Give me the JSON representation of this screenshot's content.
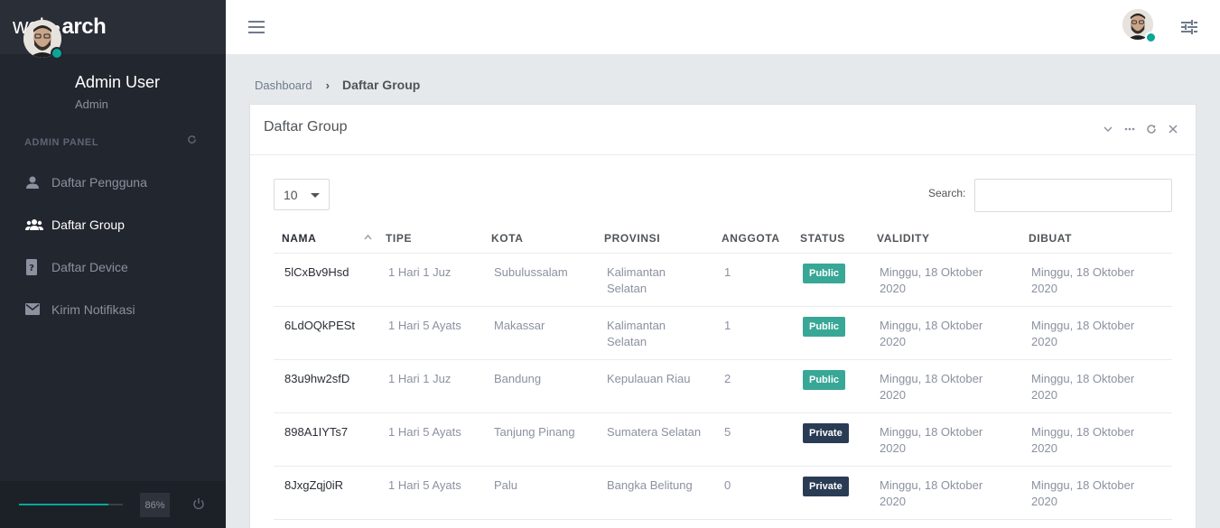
{
  "brand": {
    "part1": "web",
    "part2": "arch"
  },
  "colors": {
    "accent": "#0aa699",
    "sidebar_bg": "#22262e",
    "public_badge": "#38a796",
    "private_badge": "#2a3b54"
  },
  "user": {
    "name": "Admin User",
    "role": "Admin",
    "avatar": "avatar-photo"
  },
  "sidebar": {
    "panel_title": "ADMIN PANEL",
    "items": [
      {
        "label": "Daftar Pengguna",
        "icon": "user-icon",
        "active": false
      },
      {
        "label": "Daftar Group",
        "icon": "users-icon",
        "active": true
      },
      {
        "label": "Daftar Device",
        "icon": "device-icon",
        "active": false
      },
      {
        "label": "Kirim Notifikasi",
        "icon": "envelope-icon",
        "active": false
      }
    ],
    "footer": {
      "progress_value": 0.86,
      "progress_label": "86%"
    }
  },
  "breadcrumb": {
    "home": "Dashboard",
    "separator": "›",
    "current": "Daftar Group"
  },
  "card": {
    "title": "Daftar Group"
  },
  "table_controls": {
    "page_length": "10",
    "search_label": "Search:",
    "search_value": ""
  },
  "table": {
    "headers": [
      "NAMA",
      "TIPE",
      "KOTA",
      "PROVINSI",
      "ANGGOTA",
      "STATUS",
      "VALIDITY",
      "DIBUAT"
    ],
    "rows": [
      {
        "nama": "5lCxBv9Hsd",
        "tipe": "1 Hari 1 Juz",
        "kota": "Subulussalam",
        "provinsi": "Kalimantan Selatan",
        "anggota": "1",
        "status": "Public",
        "validity": "Minggu, 18 Oktober 2020",
        "dibuat": "Minggu, 18 Oktober 2020"
      },
      {
        "nama": "6LdOQkPESt",
        "tipe": "1 Hari 5 Ayats",
        "kota": "Makassar",
        "provinsi": "Kalimantan Selatan",
        "anggota": "1",
        "status": "Public",
        "validity": "Minggu, 18 Oktober 2020",
        "dibuat": "Minggu, 18 Oktober 2020"
      },
      {
        "nama": "83u9hw2sfD",
        "tipe": "1 Hari 1 Juz",
        "kota": "Bandung",
        "provinsi": "Kepulauan Riau",
        "anggota": "2",
        "status": "Public",
        "validity": "Minggu, 18 Oktober 2020",
        "dibuat": "Minggu, 18 Oktober 2020"
      },
      {
        "nama": "898A1IYTs7",
        "tipe": "1 Hari 5 Ayats",
        "kota": "Tanjung Pinang",
        "provinsi": "Sumatera Selatan",
        "anggota": "5",
        "status": "Private",
        "validity": "Minggu, 18 Oktober 2020",
        "dibuat": "Minggu, 18 Oktober 2020"
      },
      {
        "nama": "8JxgZqj0iR",
        "tipe": "1 Hari 5 Ayats",
        "kota": "Palu",
        "provinsi": "Bangka Belitung",
        "anggota": "0",
        "status": "Private",
        "validity": "Minggu, 18 Oktober 2020",
        "dibuat": "Minggu, 18 Oktober 2020"
      }
    ]
  }
}
